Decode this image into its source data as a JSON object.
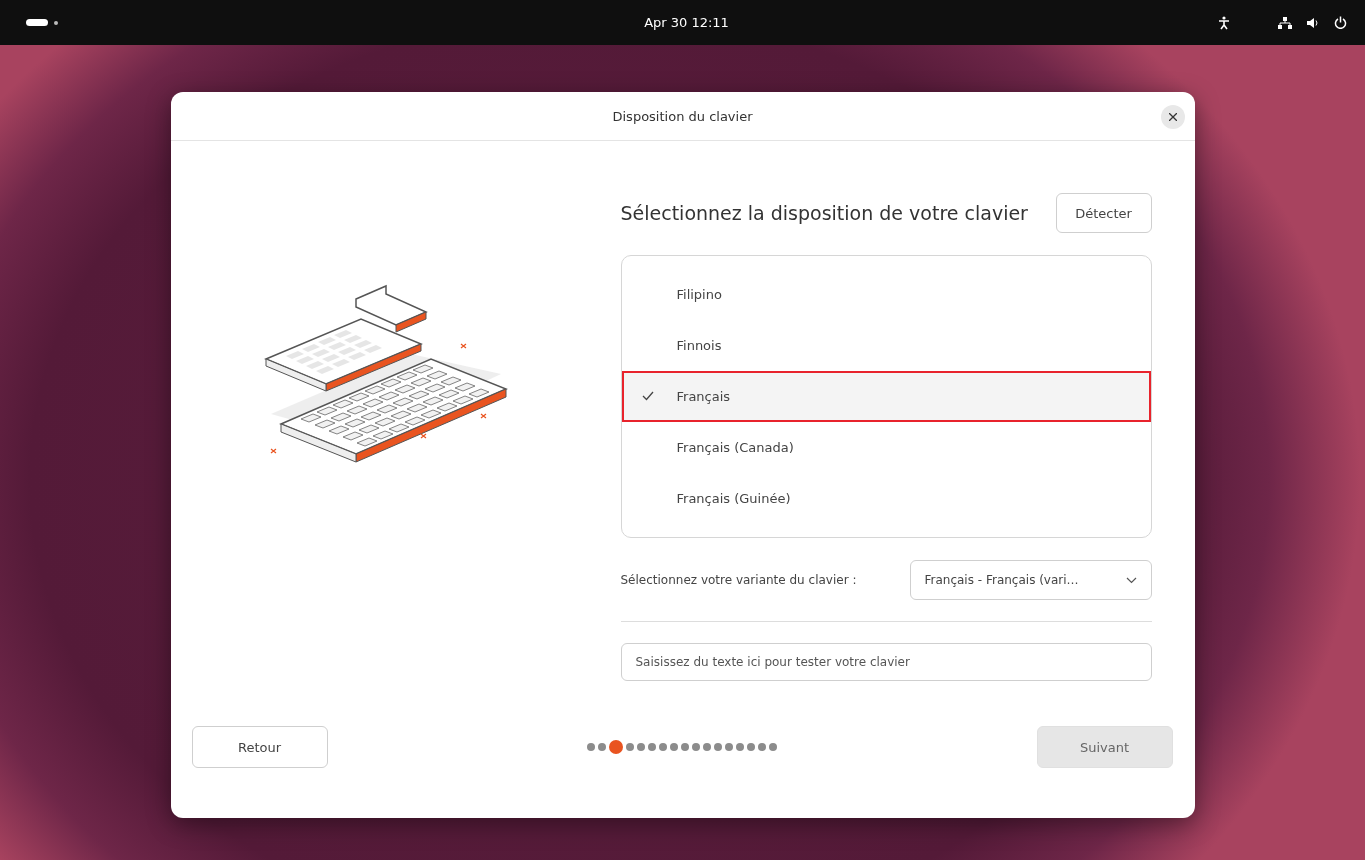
{
  "top_bar": {
    "clock": "Apr 30  12:11"
  },
  "dialog": {
    "title": "Disposition du clavier"
  },
  "heading": "Sélectionnez la disposition de votre clavier",
  "detect_button": "Détecter",
  "layouts": [
    {
      "label": "Filipino",
      "selected": false
    },
    {
      "label": "Finnois",
      "selected": false
    },
    {
      "label": "Français",
      "selected": true
    },
    {
      "label": "Français (Canada)",
      "selected": false
    },
    {
      "label": "Français (Guinée)",
      "selected": false
    }
  ],
  "variant": {
    "label": "Sélectionnez votre variante du clavier :",
    "value": "Français - Français (vari…"
  },
  "test_field": {
    "placeholder": "Saisissez du texte ici pour tester votre clavier"
  },
  "back_button": "Retour",
  "next_button": {
    "label": "Suivant",
    "disabled": true
  },
  "steps": [
    {
      "selected": false
    },
    {
      "selected": false
    },
    {
      "selected": true
    },
    {
      "selected": false
    },
    {
      "selected": false
    },
    {
      "selected": false
    },
    {
      "selected": false
    },
    {
      "selected": false
    },
    {
      "selected": false
    },
    {
      "selected": false
    },
    {
      "selected": false
    },
    {
      "selected": false
    },
    {
      "selected": false
    },
    {
      "selected": false
    },
    {
      "selected": false
    },
    {
      "selected": false
    },
    {
      "selected": false
    }
  ]
}
